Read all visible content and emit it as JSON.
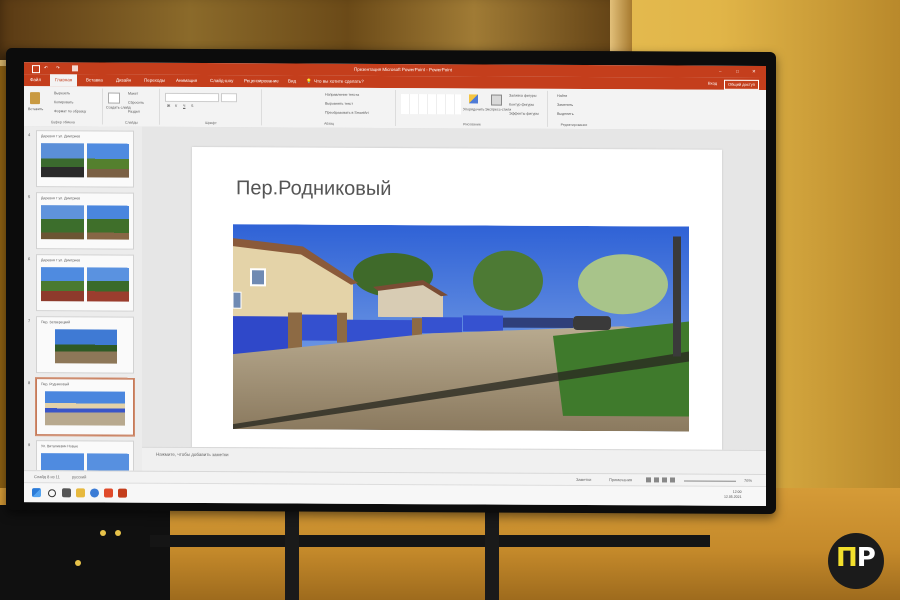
{
  "window": {
    "title": "Презентация Microsoft PowerPoint - PowerPoint",
    "sign_in": "Вход",
    "share": "Общий доступ"
  },
  "ribbon": {
    "tabs": [
      {
        "label": "Файл"
      },
      {
        "label": "Главная",
        "active": true
      },
      {
        "label": "Вставка"
      },
      {
        "label": "Дизайн"
      },
      {
        "label": "Переходы"
      },
      {
        "label": "Анимация"
      },
      {
        "label": "Слайд-шоу"
      },
      {
        "label": "Рецензирование"
      },
      {
        "label": "Вид"
      }
    ],
    "tell_me": "Что вы хотите сделать?",
    "groups": {
      "clipboard": {
        "label": "Буфер обмена",
        "paste": "Вставить",
        "cut": "Вырезать",
        "copy": "Копировать",
        "format": "Формат по образцу"
      },
      "slides": {
        "label": "Слайды",
        "new_slide": "Создать слайд",
        "layout": "Макет",
        "reset": "Сбросить",
        "section": "Раздел"
      },
      "font": {
        "label": "Шрифт"
      },
      "paragraph": {
        "label": "Абзац",
        "text_direction": "Направление текста",
        "align_text": "Выровнять текст",
        "smartart": "Преобразовать в SmartArt"
      },
      "drawing": {
        "label": "Рисование",
        "arrange": "Упорядочить",
        "quick_styles": "Экспресс-стили",
        "shape_fill": "Заливка фигуры",
        "shape_outline": "Контур фигуры",
        "shape_effects": "Эффекты фигуры"
      },
      "editing": {
        "label": "Редактирование",
        "find": "Найти",
        "replace": "Заменить",
        "select": "Выделить"
      }
    }
  },
  "thumbnails": [
    {
      "num": "4",
      "title": "Деревня т ул. Дмитриев",
      "selected": false
    },
    {
      "num": "5",
      "title": "Деревня т ул. Дмитриев",
      "selected": false
    },
    {
      "num": "6",
      "title": "Деревня т ул. Дмитриев",
      "selected": false
    },
    {
      "num": "7",
      "title": "Пер. Затверецкий",
      "selected": false
    },
    {
      "num": "8",
      "title": "Пер. Родниковый",
      "selected": true
    },
    {
      "num": "9",
      "title": "Ул. Виталиевич Новые",
      "selected": false
    }
  ],
  "slide": {
    "title": "Пер.Родниковый"
  },
  "notes_placeholder": "Нажмите, чтобы добавить заметки",
  "status": {
    "slide_info": "Слайд 8 из 11",
    "language": "русский",
    "notes": "Заметки",
    "comments": "Примечания",
    "zoom": "76%"
  },
  "taskbar": {
    "time": "12:00",
    "date": "12.05.2021"
  },
  "logo": {
    "text_a": "П",
    "text_b": "Р",
    "primary_color": "#f3e02c"
  },
  "colors": {
    "powerpoint_accent": "#c43e1c"
  }
}
